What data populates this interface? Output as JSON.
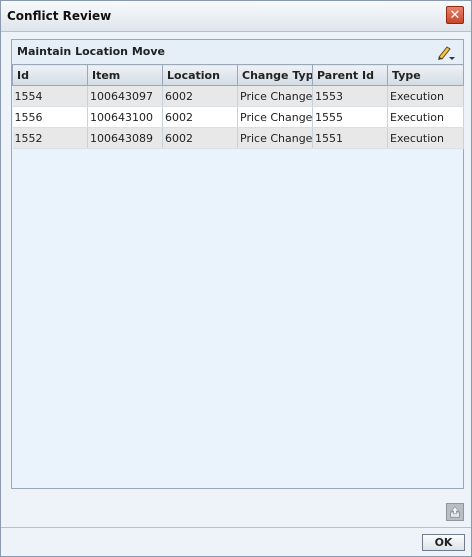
{
  "dialog": {
    "title": "Conflict Review",
    "close_label": "✕"
  },
  "panel": {
    "title": "Maintain Location Move"
  },
  "table": {
    "columns": [
      "Id",
      "Item",
      "Location",
      "Change Type",
      "Parent Id",
      "Type"
    ],
    "rows": [
      [
        "1554",
        "100643097",
        "6002",
        "Price Change",
        "1553",
        "Execution"
      ],
      [
        "1556",
        "100643100",
        "6002",
        "Price Change",
        "1555",
        "Execution"
      ],
      [
        "1552",
        "100643089",
        "6002",
        "Price Change",
        "1551",
        "Execution"
      ]
    ]
  },
  "footer": {
    "ok_label": "OK"
  },
  "icons": {
    "edit": "pencil-menu-icon",
    "export": "export-icon",
    "close": "close-icon"
  },
  "colors": {
    "close_red": "#c7452b",
    "panel_bg": "#eaf3fc",
    "header_bg": "#d3dbe4",
    "row_alt": "#e8e8e8"
  }
}
